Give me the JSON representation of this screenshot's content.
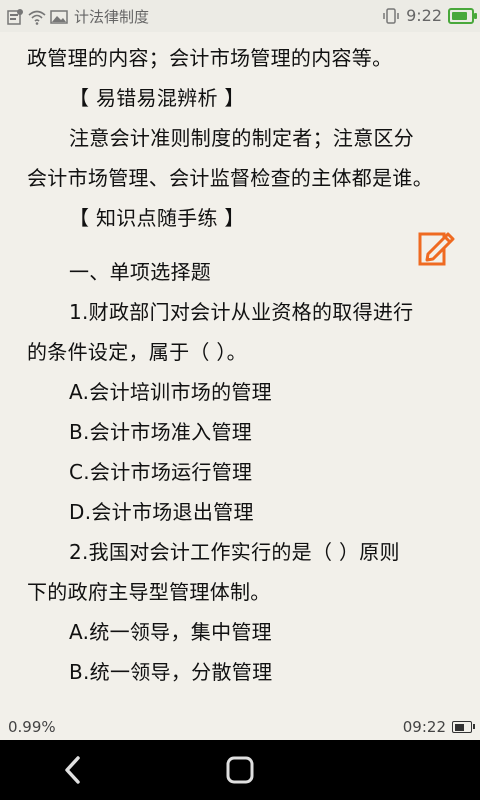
{
  "status_bar": {
    "app_title": "计法律制度",
    "time": "9:22",
    "battery_level": 0.85,
    "icons": [
      "notification-icon",
      "wifi-icon",
      "image-icon",
      "vibrate-icon",
      "battery-icon"
    ]
  },
  "content": {
    "lines": [
      "政管理的内容；会计市场管理的内容等。",
      "【 易错易混辨析 】",
      "注意会计准则制度的制定者；注意区分",
      "会计市场管理、会计监督检查的主体都是谁。",
      "【 知识点随手练 】",
      "一、单项选择题",
      "1.财政部门对会计从业资格的取得进行",
      "的条件设定，属于（    ）。",
      "A.会计培训市场的管理",
      "B.会计市场准入管理",
      "C.会计市场运行管理",
      "D.会计市场退出管理",
      "2.我国对会计工作实行的是（    ）原则",
      "下的政府主导型管理体制。",
      "A.统一领导，集中管理",
      "B.统一领导，分散管理"
    ]
  },
  "footer": {
    "progress": "0.99%",
    "time": "09:22",
    "battery_level": 0.6
  },
  "nav": {
    "icons": [
      "back-icon",
      "home-icon"
    ]
  },
  "colors": {
    "page_bg": "#f2f0ea",
    "accent_orange": "#ef6a21",
    "battery_green": "#49a83b"
  }
}
